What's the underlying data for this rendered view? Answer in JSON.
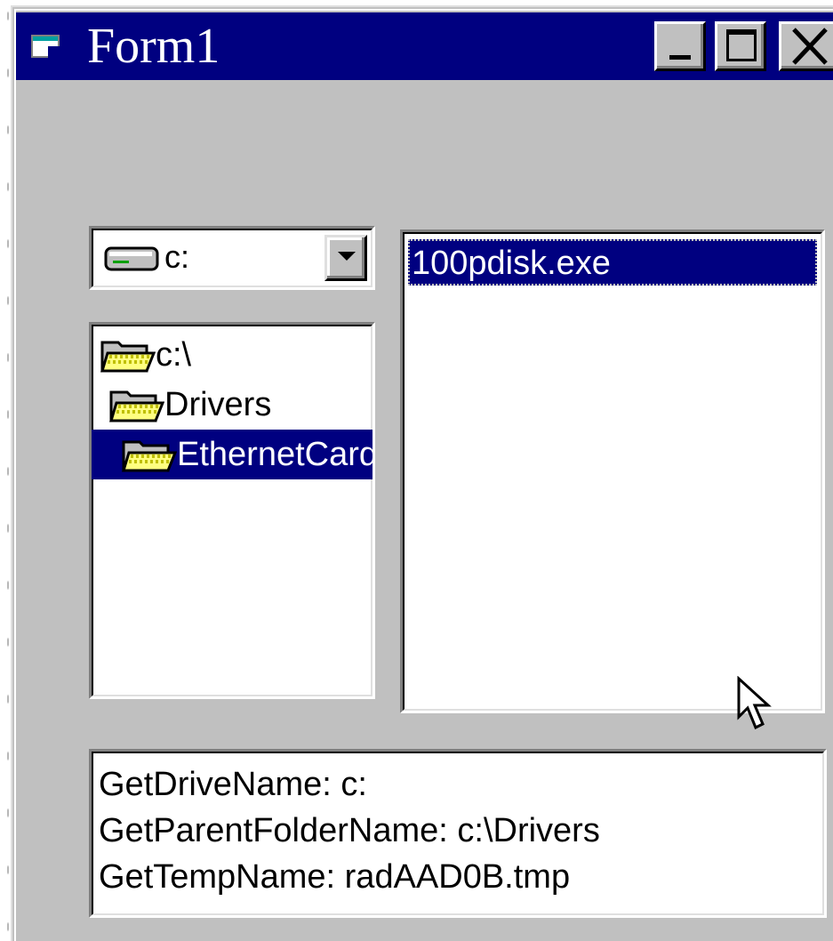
{
  "window": {
    "title": "Form1"
  },
  "title_buttons": {
    "minimize": "_",
    "close": "X"
  },
  "drive_list": {
    "selected": "c:"
  },
  "dir_list": {
    "items": [
      {
        "label": "c:\\"
      },
      {
        "label": "Drivers"
      },
      {
        "label": "EthernetCard"
      }
    ]
  },
  "file_list": {
    "items": [
      {
        "label": "100pdisk.exe"
      }
    ]
  },
  "text_box": {
    "lines": [
      "GetDriveName: c:",
      "GetParentFolderName: c:\\Drivers",
      "GetTempName: radAAD0B.tmp"
    ]
  },
  "colors": {
    "titlebar": "#000080",
    "face": "#c0c0c0",
    "selection": "#000080"
  }
}
